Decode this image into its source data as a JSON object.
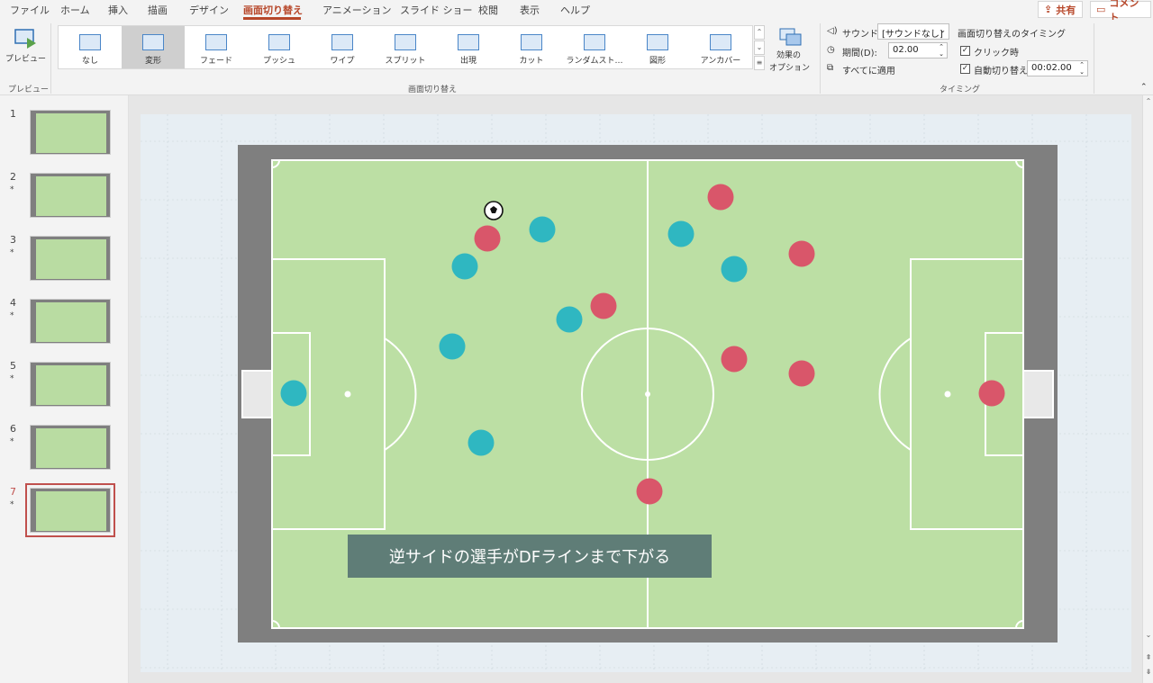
{
  "menu": {
    "tabs": [
      "ファイル",
      "ホーム",
      "挿入",
      "描画",
      "デザイン",
      "画面切り替え",
      "アニメーション",
      "スライド ショー",
      "校閲",
      "表示",
      "ヘルプ"
    ],
    "active_tab": "画面切り替え",
    "share_label": "共有",
    "comment_label": "コメント"
  },
  "ribbon": {
    "preview_label": "プレビュー",
    "preview_group": "プレビュー",
    "transitions": [
      {
        "label": "なし",
        "icon": "none-transition-icon"
      },
      {
        "label": "変形",
        "icon": "morph-transition-icon"
      },
      {
        "label": "フェード",
        "icon": "fade-transition-icon"
      },
      {
        "label": "プッシュ",
        "icon": "push-transition-icon"
      },
      {
        "label": "ワイプ",
        "icon": "wipe-transition-icon"
      },
      {
        "label": "スプリット",
        "icon": "split-transition-icon"
      },
      {
        "label": "出現",
        "icon": "reveal-transition-icon"
      },
      {
        "label": "カット",
        "icon": "cut-transition-icon"
      },
      {
        "label": "ランダムスト…",
        "icon": "random-bars-transition-icon"
      },
      {
        "label": "図形",
        "icon": "shape-transition-icon"
      },
      {
        "label": "アンカバー",
        "icon": "uncover-transition-icon"
      }
    ],
    "selected_transition": "変形",
    "effect_options_label_1": "効果の",
    "effect_options_label_2": "オプション",
    "transitions_group": "画面切り替え",
    "sound_label": "サウンド:",
    "sound_value": "[サウンドなし]",
    "duration_label": "期間(D):",
    "duration_value": "02.00",
    "apply_all_label": "すべてに適用",
    "advance_title": "画面切り替えのタイミング",
    "on_click_label": "クリック時",
    "on_click_checked": true,
    "auto_after_label": "自動切り替え",
    "auto_after_checked": true,
    "auto_after_value": "00:02.00",
    "timing_group": "タイミング"
  },
  "thumbnails": [
    {
      "number": "1",
      "star": ""
    },
    {
      "number": "2",
      "star": "*"
    },
    {
      "number": "3",
      "star": "*"
    },
    {
      "number": "4",
      "star": "*"
    },
    {
      "number": "5",
      "star": "*"
    },
    {
      "number": "6",
      "star": "*"
    },
    {
      "number": "7",
      "star": "*"
    }
  ],
  "selected_slide": "7",
  "slide": {
    "caption": "逆サイドの選手がDFラインまで下がる",
    "colors": {
      "field": "#bcdfa4",
      "border": "#7f7f7f",
      "lines": "#ffffff",
      "team_a": "#2fb7c1",
      "team_b": "#d9566a",
      "caption_bg": "#5f7d77"
    },
    "team_a_label": "blue team",
    "team_b_label": "red team"
  }
}
